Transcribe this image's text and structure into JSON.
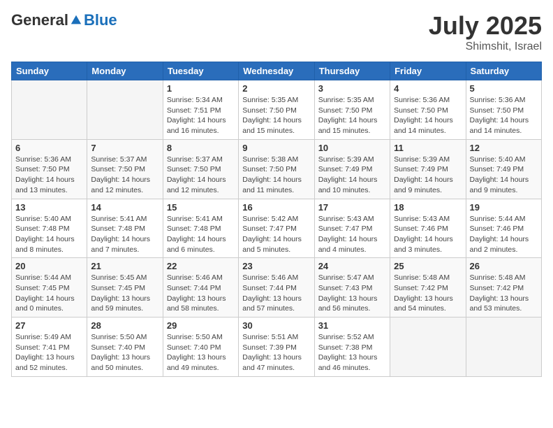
{
  "logo": {
    "general": "General",
    "blue": "Blue"
  },
  "title": {
    "month_year": "July 2025",
    "location": "Shimshit, Israel"
  },
  "days_of_week": [
    "Sunday",
    "Monday",
    "Tuesday",
    "Wednesday",
    "Thursday",
    "Friday",
    "Saturday"
  ],
  "weeks": [
    [
      {
        "day": "",
        "content": ""
      },
      {
        "day": "",
        "content": ""
      },
      {
        "day": "1",
        "content": "Sunrise: 5:34 AM\nSunset: 7:51 PM\nDaylight: 14 hours and 16 minutes."
      },
      {
        "day": "2",
        "content": "Sunrise: 5:35 AM\nSunset: 7:50 PM\nDaylight: 14 hours and 15 minutes."
      },
      {
        "day": "3",
        "content": "Sunrise: 5:35 AM\nSunset: 7:50 PM\nDaylight: 14 hours and 15 minutes."
      },
      {
        "day": "4",
        "content": "Sunrise: 5:36 AM\nSunset: 7:50 PM\nDaylight: 14 hours and 14 minutes."
      },
      {
        "day": "5",
        "content": "Sunrise: 5:36 AM\nSunset: 7:50 PM\nDaylight: 14 hours and 14 minutes."
      }
    ],
    [
      {
        "day": "6",
        "content": "Sunrise: 5:36 AM\nSunset: 7:50 PM\nDaylight: 14 hours and 13 minutes."
      },
      {
        "day": "7",
        "content": "Sunrise: 5:37 AM\nSunset: 7:50 PM\nDaylight: 14 hours and 12 minutes."
      },
      {
        "day": "8",
        "content": "Sunrise: 5:37 AM\nSunset: 7:50 PM\nDaylight: 14 hours and 12 minutes."
      },
      {
        "day": "9",
        "content": "Sunrise: 5:38 AM\nSunset: 7:50 PM\nDaylight: 14 hours and 11 minutes."
      },
      {
        "day": "10",
        "content": "Sunrise: 5:39 AM\nSunset: 7:49 PM\nDaylight: 14 hours and 10 minutes."
      },
      {
        "day": "11",
        "content": "Sunrise: 5:39 AM\nSunset: 7:49 PM\nDaylight: 14 hours and 9 minutes."
      },
      {
        "day": "12",
        "content": "Sunrise: 5:40 AM\nSunset: 7:49 PM\nDaylight: 14 hours and 9 minutes."
      }
    ],
    [
      {
        "day": "13",
        "content": "Sunrise: 5:40 AM\nSunset: 7:48 PM\nDaylight: 14 hours and 8 minutes."
      },
      {
        "day": "14",
        "content": "Sunrise: 5:41 AM\nSunset: 7:48 PM\nDaylight: 14 hours and 7 minutes."
      },
      {
        "day": "15",
        "content": "Sunrise: 5:41 AM\nSunset: 7:48 PM\nDaylight: 14 hours and 6 minutes."
      },
      {
        "day": "16",
        "content": "Sunrise: 5:42 AM\nSunset: 7:47 PM\nDaylight: 14 hours and 5 minutes."
      },
      {
        "day": "17",
        "content": "Sunrise: 5:43 AM\nSunset: 7:47 PM\nDaylight: 14 hours and 4 minutes."
      },
      {
        "day": "18",
        "content": "Sunrise: 5:43 AM\nSunset: 7:46 PM\nDaylight: 14 hours and 3 minutes."
      },
      {
        "day": "19",
        "content": "Sunrise: 5:44 AM\nSunset: 7:46 PM\nDaylight: 14 hours and 2 minutes."
      }
    ],
    [
      {
        "day": "20",
        "content": "Sunrise: 5:44 AM\nSunset: 7:45 PM\nDaylight: 14 hours and 0 minutes."
      },
      {
        "day": "21",
        "content": "Sunrise: 5:45 AM\nSunset: 7:45 PM\nDaylight: 13 hours and 59 minutes."
      },
      {
        "day": "22",
        "content": "Sunrise: 5:46 AM\nSunset: 7:44 PM\nDaylight: 13 hours and 58 minutes."
      },
      {
        "day": "23",
        "content": "Sunrise: 5:46 AM\nSunset: 7:44 PM\nDaylight: 13 hours and 57 minutes."
      },
      {
        "day": "24",
        "content": "Sunrise: 5:47 AM\nSunset: 7:43 PM\nDaylight: 13 hours and 56 minutes."
      },
      {
        "day": "25",
        "content": "Sunrise: 5:48 AM\nSunset: 7:42 PM\nDaylight: 13 hours and 54 minutes."
      },
      {
        "day": "26",
        "content": "Sunrise: 5:48 AM\nSunset: 7:42 PM\nDaylight: 13 hours and 53 minutes."
      }
    ],
    [
      {
        "day": "27",
        "content": "Sunrise: 5:49 AM\nSunset: 7:41 PM\nDaylight: 13 hours and 52 minutes."
      },
      {
        "day": "28",
        "content": "Sunrise: 5:50 AM\nSunset: 7:40 PM\nDaylight: 13 hours and 50 minutes."
      },
      {
        "day": "29",
        "content": "Sunrise: 5:50 AM\nSunset: 7:40 PM\nDaylight: 13 hours and 49 minutes."
      },
      {
        "day": "30",
        "content": "Sunrise: 5:51 AM\nSunset: 7:39 PM\nDaylight: 13 hours and 47 minutes."
      },
      {
        "day": "31",
        "content": "Sunrise: 5:52 AM\nSunset: 7:38 PM\nDaylight: 13 hours and 46 minutes."
      },
      {
        "day": "",
        "content": ""
      },
      {
        "day": "",
        "content": ""
      }
    ]
  ]
}
